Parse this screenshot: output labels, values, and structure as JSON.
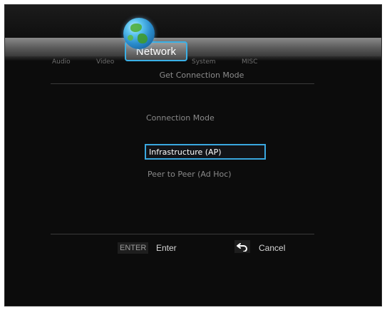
{
  "tabs": {
    "audio": "Audio",
    "video": "Video",
    "network": "Network",
    "system": "System",
    "misc": "MISC"
  },
  "page": {
    "subtitle": "Get Connection Mode",
    "section_label": "Connection Mode"
  },
  "options": [
    {
      "label": "Infrastructure (AP)",
      "selected": true
    },
    {
      "label": "Peer to Peer (Ad Hoc)",
      "selected": false
    }
  ],
  "footer": {
    "enter_key": "ENTER",
    "enter_label": "Enter",
    "cancel_icon": "back-arrow-icon",
    "cancel_label": "Cancel"
  },
  "colors": {
    "accent": "#3aa8e0",
    "background": "#0c0c0c"
  }
}
